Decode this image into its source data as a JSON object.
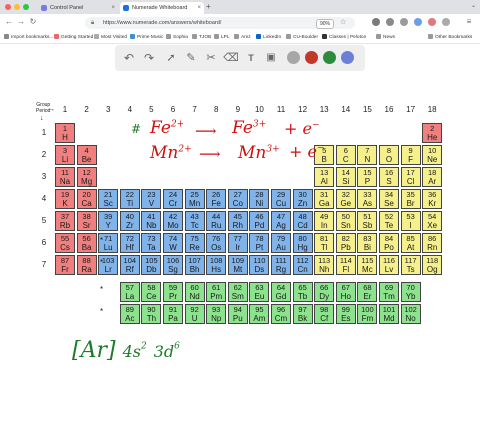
{
  "browser": {
    "tabs": [
      {
        "label": "Control Panel",
        "active": false
      },
      {
        "label": "Numerade Whiteboard",
        "active": true
      }
    ],
    "new_tab": "+",
    "url": "https://www.numerade.com/answers/whiteboard/",
    "zoom": "90%",
    "bookmarks": [
      "Import bookmarks...",
      "Getting Started",
      "Most Visited",
      "Prime Music",
      "Sophia",
      "TJOB",
      "LPL",
      "Amz",
      "LinkedIn",
      "CU-Boulder",
      "Classes | Peloton",
      "News",
      "Other Bookmarks"
    ]
  },
  "whiteboard": {
    "tools": [
      "undo-icon",
      "redo-icon",
      "pointer-icon",
      "pen-icon",
      "tools-icon",
      "eraser-icon",
      "text-icon",
      "image-icon"
    ],
    "swatch_colors": [
      "#a7a7a7",
      "#c0392b",
      "#2e8b3e",
      "#6b7fd7"
    ]
  },
  "table": {
    "group_period_label": "Group\nPeriod",
    "groups": [
      "1",
      "2",
      "3",
      "4",
      "5",
      "6",
      "7",
      "8",
      "9",
      "10",
      "11",
      "12",
      "13",
      "14",
      "15",
      "16",
      "17",
      "18"
    ],
    "periods": [
      "1",
      "2",
      "3",
      "4",
      "5",
      "6",
      "7"
    ],
    "lanthanide_marker": "*",
    "actinide_marker": "*",
    "colors": {
      "s": "#f08080",
      "d": "#7fb3ea",
      "p": "#f5f08c",
      "f": "#8de38d"
    },
    "elements": [
      {
        "n": "1",
        "s": "H",
        "b": "s",
        "r": 1,
        "c": 1
      },
      {
        "n": "2",
        "s": "He",
        "b": "s",
        "r": 1,
        "c": 18
      },
      {
        "n": "3",
        "s": "Li",
        "b": "s",
        "r": 2,
        "c": 1
      },
      {
        "n": "4",
        "s": "Be",
        "b": "s",
        "r": 2,
        "c": 2
      },
      {
        "n": "5",
        "s": "B",
        "b": "p",
        "r": 2,
        "c": 13
      },
      {
        "n": "6",
        "s": "C",
        "b": "p",
        "r": 2,
        "c": 14
      },
      {
        "n": "7",
        "s": "N",
        "b": "p",
        "r": 2,
        "c": 15
      },
      {
        "n": "8",
        "s": "O",
        "b": "p",
        "r": 2,
        "c": 16
      },
      {
        "n": "9",
        "s": "F",
        "b": "p",
        "r": 2,
        "c": 17
      },
      {
        "n": "10",
        "s": "Ne",
        "b": "p",
        "r": 2,
        "c": 18
      },
      {
        "n": "11",
        "s": "Na",
        "b": "s",
        "r": 3,
        "c": 1
      },
      {
        "n": "12",
        "s": "Mg",
        "b": "s",
        "r": 3,
        "c": 2
      },
      {
        "n": "13",
        "s": "Al",
        "b": "p",
        "r": 3,
        "c": 13
      },
      {
        "n": "14",
        "s": "Si",
        "b": "p",
        "r": 3,
        "c": 14
      },
      {
        "n": "15",
        "s": "P",
        "b": "p",
        "r": 3,
        "c": 15
      },
      {
        "n": "16",
        "s": "S",
        "b": "p",
        "r": 3,
        "c": 16
      },
      {
        "n": "17",
        "s": "Cl",
        "b": "p",
        "r": 3,
        "c": 17
      },
      {
        "n": "18",
        "s": "Ar",
        "b": "p",
        "r": 3,
        "c": 18
      },
      {
        "n": "19",
        "s": "K",
        "b": "s",
        "r": 4,
        "c": 1
      },
      {
        "n": "20",
        "s": "Ca",
        "b": "s",
        "r": 4,
        "c": 2
      },
      {
        "n": "21",
        "s": "Sc",
        "b": "d",
        "r": 4,
        "c": 3
      },
      {
        "n": "22",
        "s": "Ti",
        "b": "d",
        "r": 4,
        "c": 4
      },
      {
        "n": "23",
        "s": "V",
        "b": "d",
        "r": 4,
        "c": 5
      },
      {
        "n": "24",
        "s": "Cr",
        "b": "d",
        "r": 4,
        "c": 6
      },
      {
        "n": "25",
        "s": "Mn",
        "b": "d",
        "r": 4,
        "c": 7
      },
      {
        "n": "26",
        "s": "Fe",
        "b": "d",
        "r": 4,
        "c": 8
      },
      {
        "n": "27",
        "s": "Co",
        "b": "d",
        "r": 4,
        "c": 9
      },
      {
        "n": "28",
        "s": "Ni",
        "b": "d",
        "r": 4,
        "c": 10
      },
      {
        "n": "29",
        "s": "Cu",
        "b": "d",
        "r": 4,
        "c": 11
      },
      {
        "n": "30",
        "s": "Zn",
        "b": "d",
        "r": 4,
        "c": 12
      },
      {
        "n": "31",
        "s": "Ga",
        "b": "p",
        "r": 4,
        "c": 13
      },
      {
        "n": "32",
        "s": "Ge",
        "b": "p",
        "r": 4,
        "c": 14
      },
      {
        "n": "33",
        "s": "As",
        "b": "p",
        "r": 4,
        "c": 15
      },
      {
        "n": "34",
        "s": "Se",
        "b": "p",
        "r": 4,
        "c": 16
      },
      {
        "n": "35",
        "s": "Br",
        "b": "p",
        "r": 4,
        "c": 17
      },
      {
        "n": "36",
        "s": "Kr",
        "b": "p",
        "r": 4,
        "c": 18
      },
      {
        "n": "37",
        "s": "Rb",
        "b": "s",
        "r": 5,
        "c": 1
      },
      {
        "n": "38",
        "s": "Sr",
        "b": "s",
        "r": 5,
        "c": 2
      },
      {
        "n": "39",
        "s": "Y",
        "b": "d",
        "r": 5,
        "c": 3
      },
      {
        "n": "40",
        "s": "Zr",
        "b": "d",
        "r": 5,
        "c": 4
      },
      {
        "n": "41",
        "s": "Nb",
        "b": "d",
        "r": 5,
        "c": 5
      },
      {
        "n": "42",
        "s": "Mo",
        "b": "d",
        "r": 5,
        "c": 6
      },
      {
        "n": "43",
        "s": "Tc",
        "b": "d",
        "r": 5,
        "c": 7
      },
      {
        "n": "44",
        "s": "Ru",
        "b": "d",
        "r": 5,
        "c": 8
      },
      {
        "n": "45",
        "s": "Rh",
        "b": "d",
        "r": 5,
        "c": 9
      },
      {
        "n": "46",
        "s": "Pd",
        "b": "d",
        "r": 5,
        "c": 10
      },
      {
        "n": "47",
        "s": "Ag",
        "b": "d",
        "r": 5,
        "c": 11
      },
      {
        "n": "48",
        "s": "Cd",
        "b": "d",
        "r": 5,
        "c": 12
      },
      {
        "n": "49",
        "s": "In",
        "b": "p",
        "r": 5,
        "c": 13
      },
      {
        "n": "50",
        "s": "Sn",
        "b": "p",
        "r": 5,
        "c": 14
      },
      {
        "n": "51",
        "s": "Sb",
        "b": "p",
        "r": 5,
        "c": 15
      },
      {
        "n": "52",
        "s": "Te",
        "b": "p",
        "r": 5,
        "c": 16
      },
      {
        "n": "53",
        "s": "I",
        "b": "p",
        "r": 5,
        "c": 17
      },
      {
        "n": "54",
        "s": "Xe",
        "b": "p",
        "r": 5,
        "c": 18
      },
      {
        "n": "55",
        "s": "Cs",
        "b": "s",
        "r": 6,
        "c": 1
      },
      {
        "n": "56",
        "s": "Ba",
        "b": "s",
        "r": 6,
        "c": 2
      },
      {
        "n": "71",
        "s": "Lu",
        "b": "d",
        "r": 6,
        "c": 3
      },
      {
        "n": "72",
        "s": "Hf",
        "b": "d",
        "r": 6,
        "c": 4
      },
      {
        "n": "73",
        "s": "Ta",
        "b": "d",
        "r": 6,
        "c": 5
      },
      {
        "n": "74",
        "s": "W",
        "b": "d",
        "r": 6,
        "c": 6
      },
      {
        "n": "75",
        "s": "Re",
        "b": "d",
        "r": 6,
        "c": 7
      },
      {
        "n": "76",
        "s": "Os",
        "b": "d",
        "r": 6,
        "c": 8
      },
      {
        "n": "77",
        "s": "Ir",
        "b": "d",
        "r": 6,
        "c": 9
      },
      {
        "n": "78",
        "s": "Pt",
        "b": "d",
        "r": 6,
        "c": 10
      },
      {
        "n": "79",
        "s": "Au",
        "b": "d",
        "r": 6,
        "c": 11
      },
      {
        "n": "80",
        "s": "Hg",
        "b": "d",
        "r": 6,
        "c": 12
      },
      {
        "n": "81",
        "s": "Tl",
        "b": "p",
        "r": 6,
        "c": 13
      },
      {
        "n": "82",
        "s": "Pb",
        "b": "p",
        "r": 6,
        "c": 14
      },
      {
        "n": "83",
        "s": "Bi",
        "b": "p",
        "r": 6,
        "c": 15
      },
      {
        "n": "84",
        "s": "Po",
        "b": "p",
        "r": 6,
        "c": 16
      },
      {
        "n": "85",
        "s": "At",
        "b": "p",
        "r": 6,
        "c": 17
      },
      {
        "n": "86",
        "s": "Rn",
        "b": "p",
        "r": 6,
        "c": 18
      },
      {
        "n": "87",
        "s": "Fr",
        "b": "s",
        "r": 7,
        "c": 1
      },
      {
        "n": "88",
        "s": "Ra",
        "b": "s",
        "r": 7,
        "c": 2
      },
      {
        "n": "103",
        "s": "Lr",
        "b": "d",
        "r": 7,
        "c": 3
      },
      {
        "n": "104",
        "s": "Rf",
        "b": "d",
        "r": 7,
        "c": 4
      },
      {
        "n": "105",
        "s": "Db",
        "b": "d",
        "r": 7,
        "c": 5
      },
      {
        "n": "106",
        "s": "Sg",
        "b": "d",
        "r": 7,
        "c": 6
      },
      {
        "n": "107",
        "s": "Bh",
        "b": "d",
        "r": 7,
        "c": 7
      },
      {
        "n": "108",
        "s": "Hs",
        "b": "d",
        "r": 7,
        "c": 8
      },
      {
        "n": "109",
        "s": "Mt",
        "b": "d",
        "r": 7,
        "c": 9
      },
      {
        "n": "110",
        "s": "Ds",
        "b": "d",
        "r": 7,
        "c": 10
      },
      {
        "n": "111",
        "s": "Rg",
        "b": "d",
        "r": 7,
        "c": 11
      },
      {
        "n": "112",
        "s": "Cn",
        "b": "d",
        "r": 7,
        "c": 12
      },
      {
        "n": "113",
        "s": "Nh",
        "b": "p",
        "r": 7,
        "c": 13
      },
      {
        "n": "114",
        "s": "Fl",
        "b": "p",
        "r": 7,
        "c": 14
      },
      {
        "n": "115",
        "s": "Mc",
        "b": "p",
        "r": 7,
        "c": 15
      },
      {
        "n": "116",
        "s": "Lv",
        "b": "p",
        "r": 7,
        "c": 16
      },
      {
        "n": "117",
        "s": "Ts",
        "b": "p",
        "r": 7,
        "c": 17
      },
      {
        "n": "118",
        "s": "Og",
        "b": "p",
        "r": 7,
        "c": 18
      },
      {
        "n": "57",
        "s": "La",
        "b": "f",
        "r": 9,
        "c": 4
      },
      {
        "n": "58",
        "s": "Ce",
        "b": "f",
        "r": 9,
        "c": 5
      },
      {
        "n": "59",
        "s": "Pr",
        "b": "f",
        "r": 9,
        "c": 6
      },
      {
        "n": "60",
        "s": "Nd",
        "b": "f",
        "r": 9,
        "c": 7
      },
      {
        "n": "61",
        "s": "Pm",
        "b": "f",
        "r": 9,
        "c": 8
      },
      {
        "n": "62",
        "s": "Sm",
        "b": "f",
        "r": 9,
        "c": 9
      },
      {
        "n": "63",
        "s": "Eu",
        "b": "f",
        "r": 9,
        "c": 10
      },
      {
        "n": "64",
        "s": "Gd",
        "b": "f",
        "r": 9,
        "c": 11
      },
      {
        "n": "65",
        "s": "Tb",
        "b": "f",
        "r": 9,
        "c": 12
      },
      {
        "n": "66",
        "s": "Dy",
        "b": "f",
        "r": 9,
        "c": 13
      },
      {
        "n": "67",
        "s": "Ho",
        "b": "f",
        "r": 9,
        "c": 14
      },
      {
        "n": "68",
        "s": "Er",
        "b": "f",
        "r": 9,
        "c": 15
      },
      {
        "n": "69",
        "s": "Tm",
        "b": "f",
        "r": 9,
        "c": 16
      },
      {
        "n": "70",
        "s": "Yb",
        "b": "f",
        "r": 9,
        "c": 17
      },
      {
        "n": "89",
        "s": "Ac",
        "b": "f",
        "r": 10,
        "c": 4
      },
      {
        "n": "90",
        "s": "Th",
        "b": "f",
        "r": 10,
        "c": 5
      },
      {
        "n": "91",
        "s": "Pa",
        "b": "f",
        "r": 10,
        "c": 6
      },
      {
        "n": "92",
        "s": "U",
        "b": "f",
        "r": 10,
        "c": 7
      },
      {
        "n": "93",
        "s": "Np",
        "b": "f",
        "r": 10,
        "c": 8
      },
      {
        "n": "94",
        "s": "Pu",
        "b": "f",
        "r": 10,
        "c": 9
      },
      {
        "n": "95",
        "s": "Am",
        "b": "f",
        "r": 10,
        "c": 10
      },
      {
        "n": "96",
        "s": "Cm",
        "b": "f",
        "r": 10,
        "c": 11
      },
      {
        "n": "97",
        "s": "Bk",
        "b": "f",
        "r": 10,
        "c": 12
      },
      {
        "n": "98",
        "s": "Cf",
        "b": "f",
        "r": 10,
        "c": 13
      },
      {
        "n": "99",
        "s": "Es",
        "b": "f",
        "r": 10,
        "c": 14
      },
      {
        "n": "100",
        "s": "Fm",
        "b": "f",
        "r": 10,
        "c": 15
      },
      {
        "n": "101",
        "s": "Md",
        "b": "f",
        "r": 10,
        "c": 16
      },
      {
        "n": "102",
        "s": "No",
        "b": "f",
        "r": 10,
        "c": 17
      }
    ]
  },
  "annotations": {
    "line1_fe": "Fe",
    "line1_fe_charge": "2+",
    "line1_fe3": "Fe",
    "line1_fe3_charge": "3+",
    "line1_plus_e": "+ e",
    "line1_e_sup": "−",
    "line2_mn": "Mn",
    "line2_mn_charge": "2+",
    "line2_mn3": "Mn",
    "line2_mn3_charge": "3+",
    "line2_plus_e": "+ e",
    "line2_e_sup": "−",
    "hash_mark": "#",
    "config_core": "[Ar]",
    "config_4s": "4s",
    "config_4s_sup": "2",
    "config_3d": "3d",
    "config_3d_sup": "6"
  }
}
